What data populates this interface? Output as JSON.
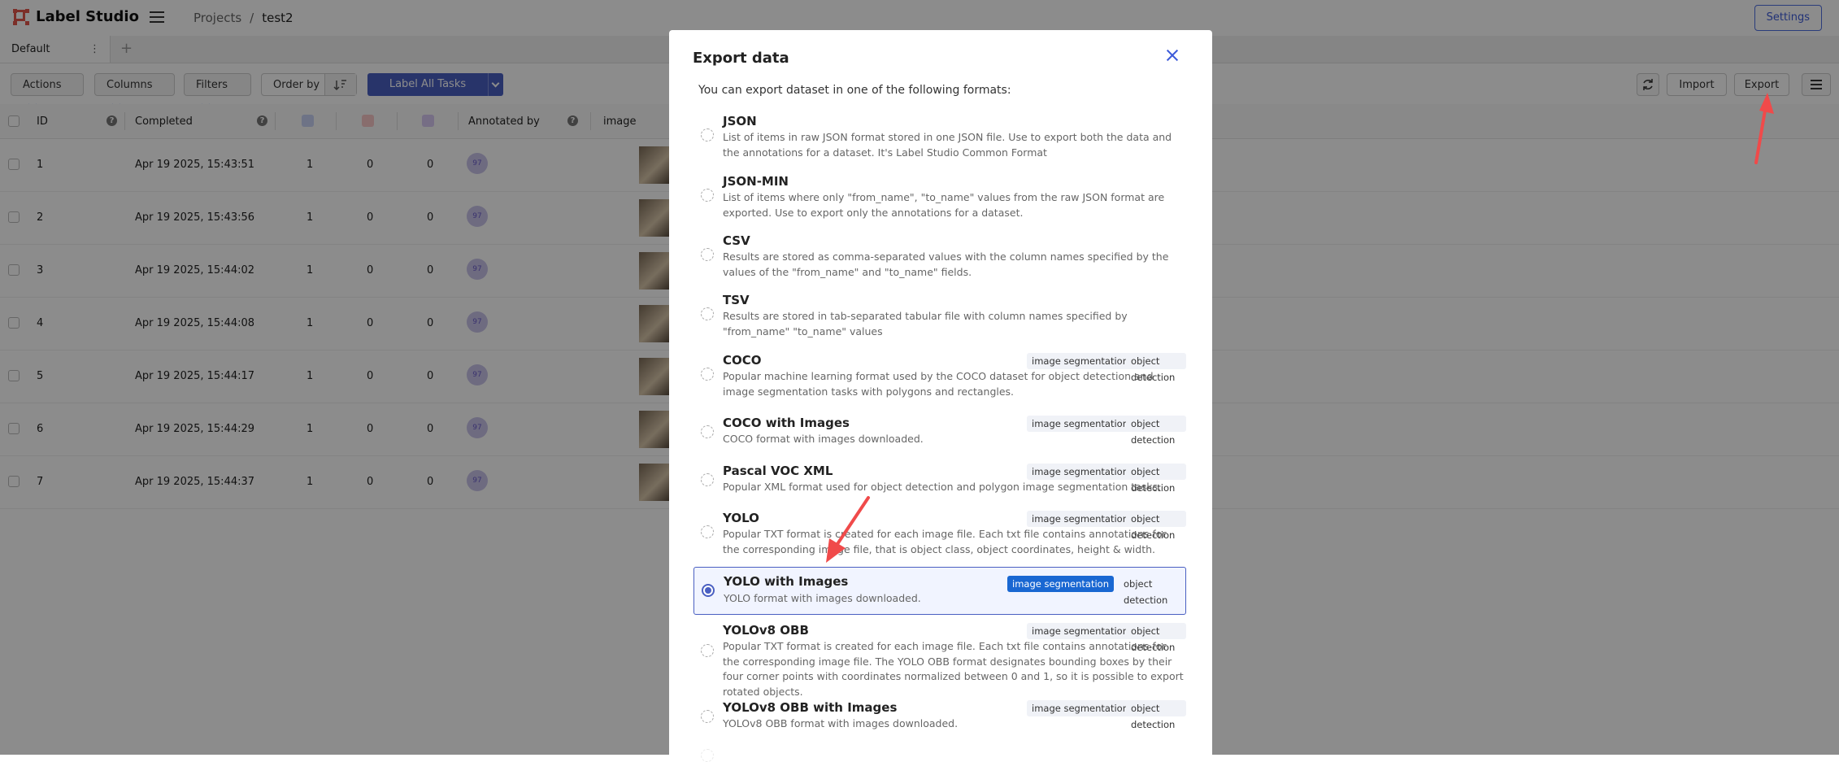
{
  "app": {
    "name": "Label Studio",
    "breadcrumb": [
      "Projects",
      "test2"
    ],
    "settings_label": "Settings"
  },
  "tabs": {
    "active": "Default",
    "menu_glyph": "⋮",
    "add_glyph": "+"
  },
  "toolbar": {
    "actions": "Actions",
    "columns": "Columns",
    "filters": "Filters",
    "order_by": "Order by",
    "label_all": "Label All Tasks",
    "import": "Import",
    "export": "Export"
  },
  "table": {
    "headers": {
      "id": "ID",
      "completed": "Completed",
      "annotated_by": "Annotated by",
      "image": "image"
    },
    "rows": [
      {
        "id": "1",
        "completed": "Apr 19 2025, 15:43:51",
        "c1": "1",
        "c2": "0",
        "c3": "0",
        "avatar": "97"
      },
      {
        "id": "2",
        "completed": "Apr 19 2025, 15:43:56",
        "c1": "1",
        "c2": "0",
        "c3": "0",
        "avatar": "97"
      },
      {
        "id": "3",
        "completed": "Apr 19 2025, 15:44:02",
        "c1": "1",
        "c2": "0",
        "c3": "0",
        "avatar": "97"
      },
      {
        "id": "4",
        "completed": "Apr 19 2025, 15:44:08",
        "c1": "1",
        "c2": "0",
        "c3": "0",
        "avatar": "97"
      },
      {
        "id": "5",
        "completed": "Apr 19 2025, 15:44:17",
        "c1": "1",
        "c2": "0",
        "c3": "0",
        "avatar": "97"
      },
      {
        "id": "6",
        "completed": "Apr 19 2025, 15:44:29",
        "c1": "1",
        "c2": "0",
        "c3": "0",
        "avatar": "97"
      },
      {
        "id": "7",
        "completed": "Apr 19 2025, 15:44:37",
        "c1": "1",
        "c2": "0",
        "c3": "0",
        "avatar": "97"
      }
    ]
  },
  "modal": {
    "title": "Export data",
    "intro": "You can export dataset in one of the following formats:",
    "formats": [
      {
        "name": "JSON",
        "desc": "List of items in raw JSON format stored in one JSON file. Use to export both the data and the annotations for a dataset. It's Label Studio Common Format",
        "tags": []
      },
      {
        "name": "JSON-MIN",
        "desc": "List of items where only \"from_name\", \"to_name\" values from the raw JSON format are exported. Use to export only the annotations for a dataset.",
        "tags": []
      },
      {
        "name": "CSV",
        "desc": "Results are stored as comma-separated values with the column names specified by the values of the \"from_name\" and \"to_name\" fields.",
        "tags": []
      },
      {
        "name": "TSV",
        "desc": "Results are stored in tab-separated tabular file with column names specified by \"from_name\" \"to_name\" values",
        "tags": []
      },
      {
        "name": "COCO",
        "desc": "Popular machine learning format used by the COCO dataset for object detection and image segmentation tasks with polygons and rectangles.",
        "tags": [
          "image segmentation",
          "object detection"
        ]
      },
      {
        "name": "COCO with Images",
        "desc": "COCO format with images downloaded.",
        "tags": [
          "image segmentation",
          "object detection"
        ]
      },
      {
        "name": "Pascal VOC XML",
        "desc": "Popular XML format used for object detection and polygon image segmentation tasks.",
        "tags": [
          "image segmentation",
          "object detection"
        ]
      },
      {
        "name": "YOLO",
        "desc": "Popular TXT format is created for each image file. Each txt file contains annotations for the corresponding image file, that is object class, object coordinates, height & width.",
        "tags": [
          "image segmentation",
          "object detection"
        ]
      },
      {
        "name": "YOLO with Images",
        "desc": "YOLO format with images downloaded.",
        "tags": [
          "image segmentation",
          "object detection"
        ],
        "selected": true
      },
      {
        "name": "YOLOv8 OBB",
        "desc": "Popular TXT format is created for each image file. Each txt file contains annotations for the corresponding image file. The YOLO OBB format designates bounding boxes by their four corner points with coordinates normalized between 0 and 1, so it is possible to export rotated objects.",
        "tags": [
          "image segmentation",
          "object detection"
        ]
      },
      {
        "name": "YOLOv8 OBB with Images",
        "desc": "YOLOv8 OBB format with images downloaded.",
        "tags": [
          "image segmentation",
          "object detection"
        ]
      }
    ]
  },
  "colors": {
    "accent": "#4a5fc2",
    "arrow": "#f04a4a",
    "highlight": "#1967d2"
  }
}
